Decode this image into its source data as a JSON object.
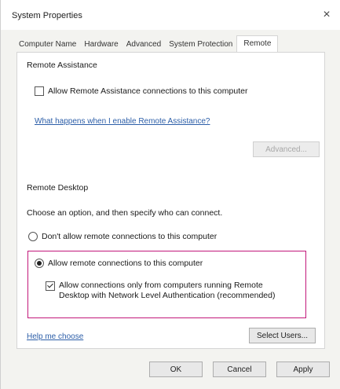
{
  "window": {
    "title": "System Properties",
    "close_glyph": "×"
  },
  "tabs": [
    {
      "label": "Computer Name"
    },
    {
      "label": "Hardware"
    },
    {
      "label": "Advanced"
    },
    {
      "label": "System Protection"
    },
    {
      "label": "Remote"
    }
  ],
  "remote_assistance": {
    "heading": "Remote Assistance",
    "allow_checkbox_label": "Allow Remote Assistance connections to this computer",
    "allow_checked": false,
    "help_link": "What happens when I enable Remote Assistance?",
    "advanced_button": "Advanced..."
  },
  "remote_desktop": {
    "heading": "Remote Desktop",
    "instruction": "Choose an option, and then specify who can connect.",
    "option_dont_allow": "Don't allow remote connections to this computer",
    "option_allow": "Allow remote connections to this computer",
    "selected_option": "allow",
    "nla_checkbox_label_line1": "Allow connections only from computers running Remote",
    "nla_checkbox_label_line2": "Desktop with Network Level Authentication (recommended)",
    "nla_checked": true,
    "help_link": "Help me choose",
    "select_users_button": "Select Users..."
  },
  "footer": {
    "ok_label": "OK",
    "cancel_label": "Cancel",
    "apply_label": "Apply"
  },
  "colors": {
    "highlight_border": "#c2187a",
    "link": "#2c5ea8"
  }
}
